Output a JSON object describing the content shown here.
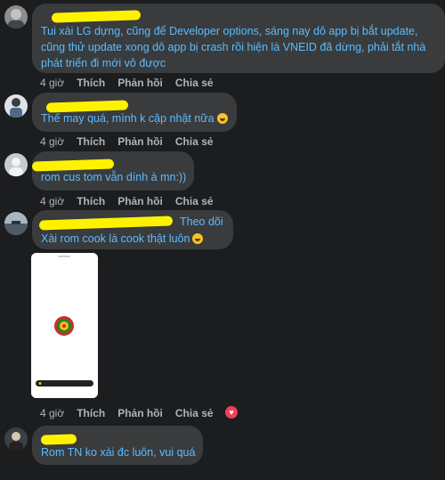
{
  "comments": [
    {
      "text": "Tui xài LG dựng, cũng để Developer options, sáng nay dô app bị bắt update, cũng thử update xong dô app bị crash rồi hiện là VNEID đã dừng, phải tắt nhà phát triển đi mới vô được",
      "time": "4 giờ",
      "like": "Thích",
      "reply": "Phản hồi",
      "share": "Chia sẻ"
    },
    {
      "text": "Thế may quá, mình k cập nhật nữa",
      "time": "4 giờ",
      "like": "Thích",
      "reply": "Phản hồi",
      "share": "Chia sẻ"
    },
    {
      "text": "rom cus tom vẫn dính à mn:))",
      "time": "4 giờ",
      "like": "Thích",
      "reply": "Phản hồi",
      "share": "Chia sẻ"
    },
    {
      "follow": "Theo dõi",
      "text": "Xài rom cook là cook thật luôn",
      "time": "4 giờ",
      "like": "Thích",
      "reply": "Phản hồi",
      "share": "Chia sẻ"
    },
    {
      "text": "Rom TN ko xài đc luôn, vui quá",
      "time": "",
      "like": "",
      "reply": "",
      "share": ""
    }
  ],
  "colors": {
    "bubble": "#3a3b3c",
    "text": "#5bbcff",
    "redaction": "#fff200",
    "heart": "#f33e58"
  },
  "icons": [
    "laughing-emoji-icon",
    "heart-reaction-icon"
  ]
}
